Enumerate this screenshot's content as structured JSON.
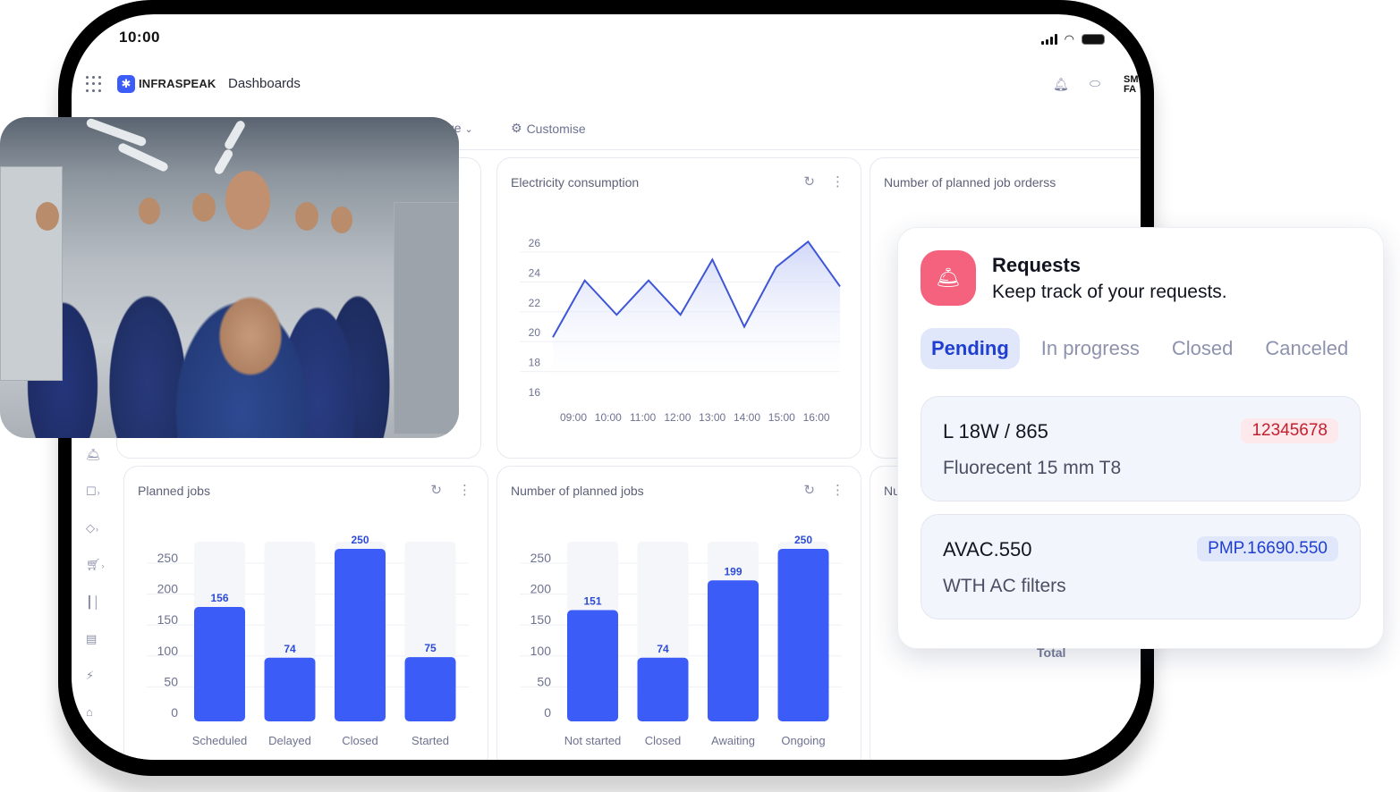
{
  "status_bar": {
    "time": "10:00"
  },
  "topbar": {
    "brand": "INFRASPEAK",
    "title": "Dashboards",
    "org_label_line1": "SM",
    "org_label_line2": "FA",
    "icons": [
      "apps-grid-icon",
      "bell-icon",
      "chat-icon"
    ]
  },
  "toolbar": {
    "page_dropdown_partial": "ge",
    "customise_label": "Customise"
  },
  "cards": {
    "electricity": {
      "title": "Electricity consumption"
    },
    "planned_job_orders": {
      "title": "Number of planned job orderss"
    },
    "planned_jobs": {
      "title": "Planned jobs"
    },
    "number_planned_jobs": {
      "title": "Number of planned jobs"
    },
    "partial_card": {
      "title_partial": "Nu"
    }
  },
  "requests": {
    "title": "Requests",
    "subtitle": "Keep track of your requests.",
    "tabs": [
      {
        "label": "Pending",
        "active": true
      },
      {
        "label": "In progress",
        "active": false
      },
      {
        "label": "Closed",
        "active": false
      },
      {
        "label": "Canceled",
        "active": false
      }
    ],
    "items": [
      {
        "code": "L 18W / 865",
        "description": "Fluorecent 15 mm T8",
        "tag": "12345678",
        "tag_color": "#c2202e"
      },
      {
        "code": "AVAC.550",
        "description": "WTH AC filters",
        "tag": "PMP.16690.550",
        "tag_color": "#1f3fd0"
      }
    ],
    "accent_color": "#f4627e"
  },
  "total_label": "Total",
  "colors": {
    "brand_blue": "#3b5cf6",
    "bar_blue": "#3c5cf7",
    "line_blue": "#3d55d6"
  },
  "chart_data": [
    {
      "type": "area",
      "title": "Electricity consumption",
      "x": [
        "09:00",
        "10:00",
        "11:00",
        "12:00",
        "13:00",
        "14:00",
        "15:00",
        "16:00"
      ],
      "values": [
        19.7,
        23.5,
        21.2,
        23.5,
        21.2,
        24.9,
        20.4,
        24.4,
        26.1,
        23.1
      ],
      "yticks": [
        16,
        18,
        20,
        22,
        24,
        26
      ],
      "ylim": [
        16,
        26
      ],
      "grid": true
    },
    {
      "type": "bar",
      "title": "Planned jobs",
      "categories": [
        "Scheduled",
        "Delayed",
        "Closed",
        "Started"
      ],
      "values": [
        156,
        74,
        250,
        75
      ],
      "yticks": [
        0,
        50,
        100,
        150,
        200,
        250
      ],
      "ylim": [
        0,
        250
      ],
      "grid": true
    },
    {
      "type": "bar",
      "title": "Number of planned jobs",
      "categories": [
        "Not started",
        "Closed",
        "Awaiting",
        "Ongoing"
      ],
      "values": [
        151,
        74,
        199,
        250
      ],
      "yticks": [
        0,
        50,
        100,
        150,
        200,
        250
      ],
      "ylim": [
        0,
        250
      ],
      "grid": true
    }
  ]
}
